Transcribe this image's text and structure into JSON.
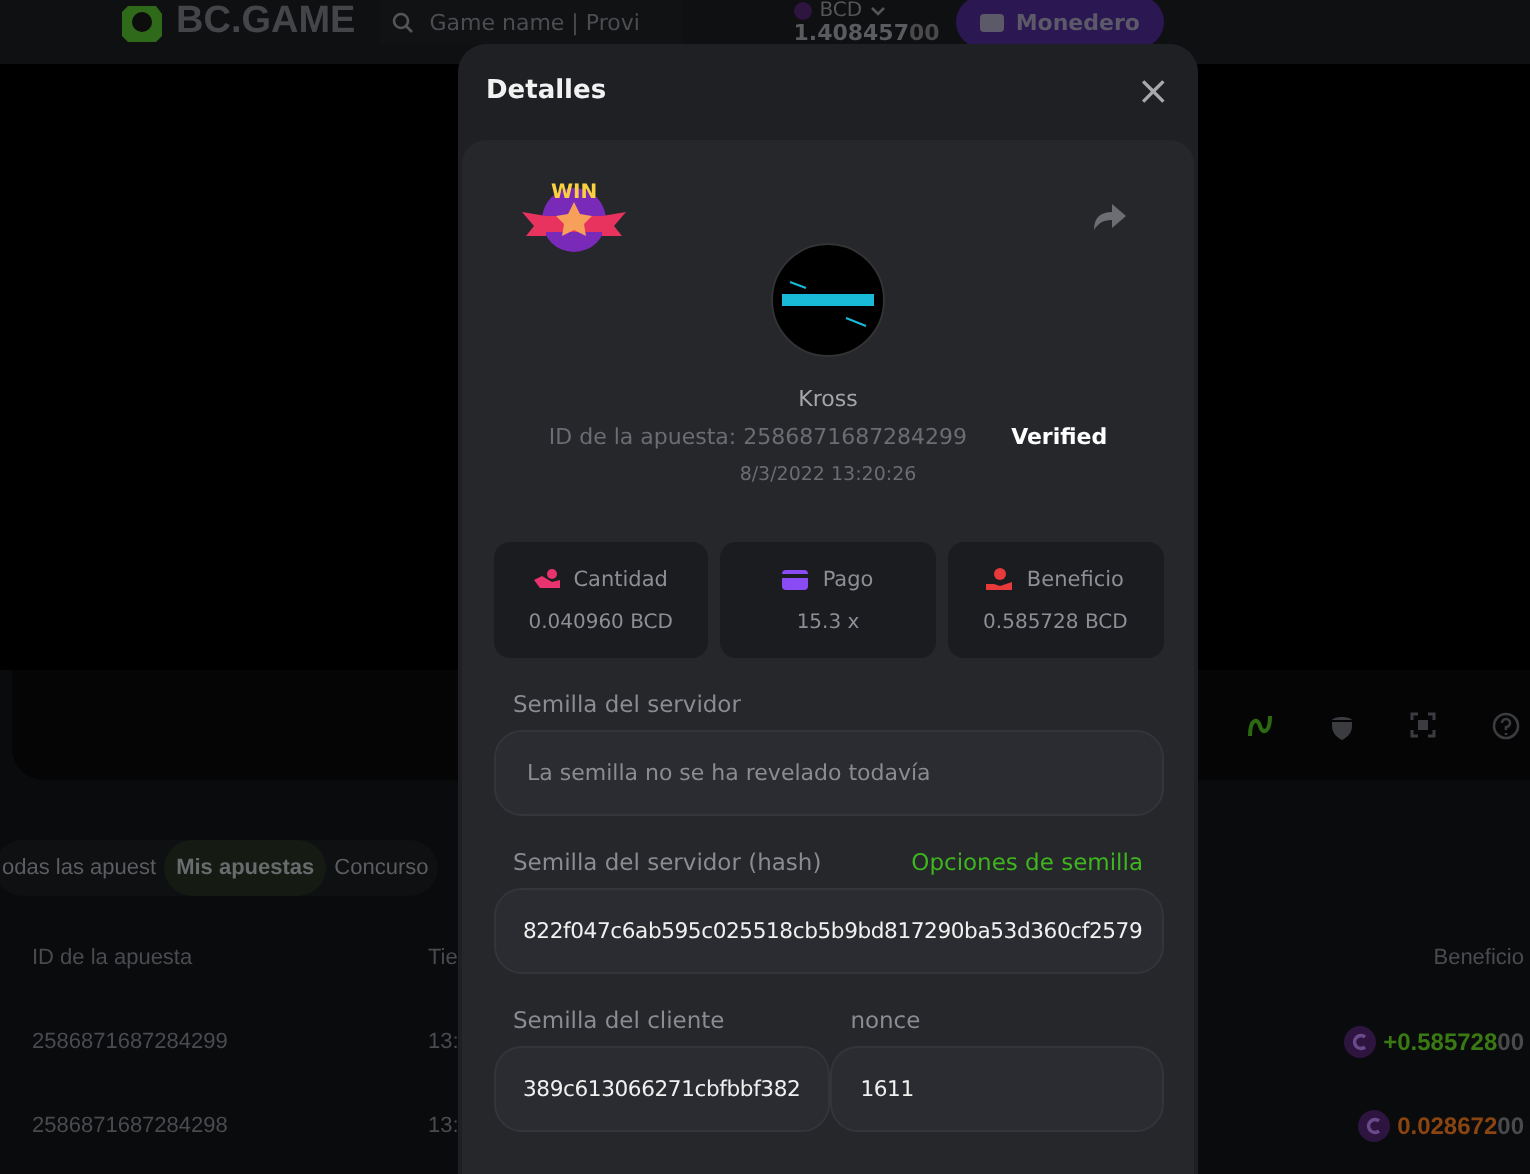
{
  "header": {
    "logo": "BC.GAME",
    "search": {
      "placeholder": "Game name | Provi"
    },
    "balance": {
      "currency": "BCD",
      "amount": "1.408457",
      "amount_tail": "00"
    },
    "wallet_button": "Monedero"
  },
  "tabs": [
    {
      "label": "odas las apuest",
      "selected": false
    },
    {
      "label": "Mis apuestas",
      "selected": true
    },
    {
      "label": "Concurso",
      "selected": false
    }
  ],
  "table": {
    "columns": [
      "ID de la apuesta",
      "Tie",
      "Beneficio"
    ],
    "rows": [
      {
        "id": "2586871687284299",
        "time": "13:",
        "profit": "+0.585728",
        "profit_tail": "00",
        "color": "#3a7a12"
      },
      {
        "id": "2586871687284298",
        "time": "13:",
        "profit": "0.028672",
        "profit_tail": "00",
        "color": "#8a4510"
      }
    ]
  },
  "modal": {
    "title": "Detalles",
    "badge": "WIN",
    "close": "×",
    "player": "Kross",
    "bet_id": "ID de la apuesta: 2586871687284299",
    "verified": "Verified",
    "date": "8/3/2022 13:20:26",
    "stats": [
      {
        "kind": "amount",
        "label": "Cantidad",
        "value": "0.040960 BCD",
        "color": "#e8336e"
      },
      {
        "kind": "payout",
        "label": "Pago",
        "value": "15.3 x",
        "color": "#8a4bf5"
      },
      {
        "kind": "profit",
        "label": "Beneficio",
        "value": "0.585728 BCD",
        "color": "#e83a3a"
      }
    ],
    "server_seed": {
      "label": "Semilla del servidor",
      "placeholder": "La semilla no se ha revelado todavía"
    },
    "server_hash": {
      "label": "Semilla del servidor (hash)",
      "link": "Opciones de semilla",
      "value": "822f047c6ab595c025518cb5b9bd817290ba53d360cf2579"
    },
    "client_seed": {
      "label": "Semilla del cliente",
      "value": "389c613066271cbfbbf382"
    },
    "nonce": {
      "label": "nonce",
      "value": "1611"
    }
  }
}
